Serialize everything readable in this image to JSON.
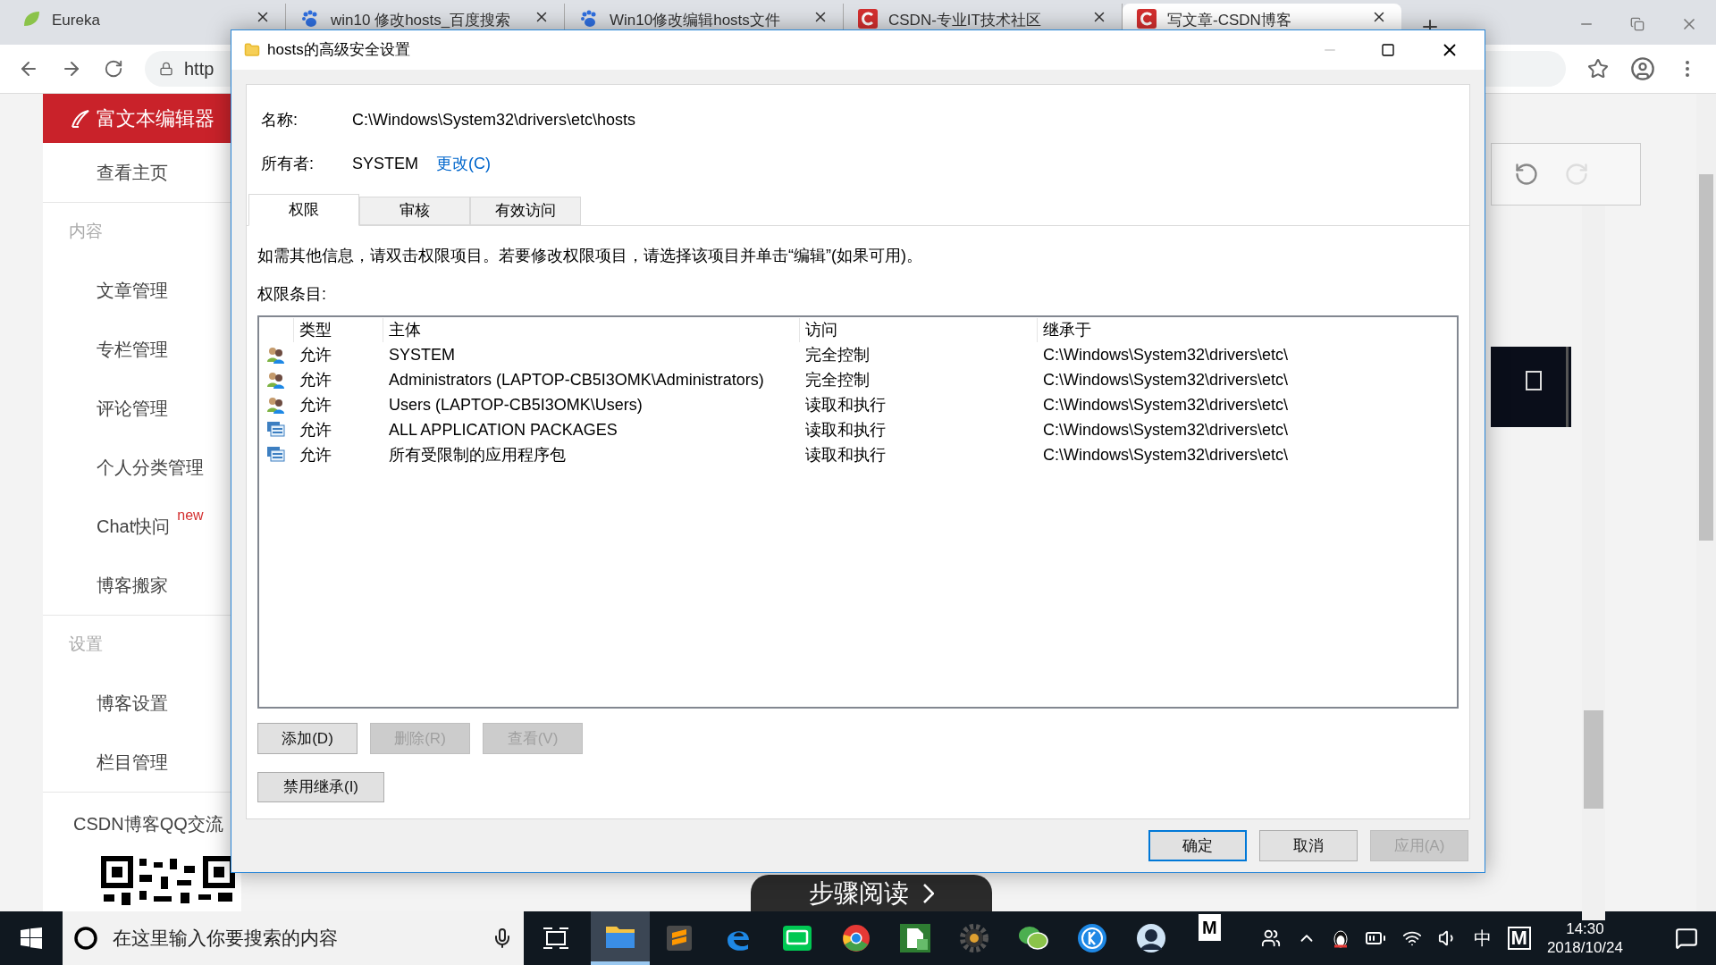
{
  "browser": {
    "tabs": [
      {
        "title": "Eureka",
        "kind": "leaf",
        "selected": false
      },
      {
        "title": "win10 修改hosts_百度搜索",
        "kind": "paw",
        "selected": false
      },
      {
        "title": "Win10修改编辑hosts文件",
        "kind": "paw",
        "selected": false
      },
      {
        "title": "CSDN-专业IT技术社区",
        "kind": "csdn",
        "selected": false
      },
      {
        "title": "写文章-CSDN博客",
        "kind": "csdn",
        "selected": true
      }
    ],
    "address": "http"
  },
  "sidebar": {
    "header": "富文本编辑器",
    "items": [
      {
        "kind": "link",
        "label": "查看主页"
      },
      {
        "kind": "heading",
        "label": "内容"
      },
      {
        "kind": "link",
        "label": "文章管理"
      },
      {
        "kind": "link",
        "label": "专栏管理"
      },
      {
        "kind": "link",
        "label": "评论管理"
      },
      {
        "kind": "link",
        "label": "个人分类管理"
      },
      {
        "kind": "link",
        "label": "Chat快问",
        "badge": "new"
      },
      {
        "kind": "link",
        "label": "博客搬家"
      },
      {
        "kind": "heading",
        "label": "设置"
      },
      {
        "kind": "link",
        "label": "博客设置"
      },
      {
        "kind": "link",
        "label": "栏目管理"
      }
    ],
    "qq_group": "CSDN博客QQ交流"
  },
  "step_reading": "步骤阅读",
  "dialog": {
    "title": "hosts的高级安全设置",
    "name_label": "名称:",
    "name_value": "C:\\Windows\\System32\\drivers\\etc\\hosts",
    "owner_label": "所有者:",
    "owner_value": "SYSTEM",
    "change_link": "更改(C)",
    "tabs": [
      {
        "label": "权限",
        "selected": true
      },
      {
        "label": "审核",
        "selected": false
      },
      {
        "label": "有效访问",
        "selected": false
      }
    ],
    "description": "如需其他信息，请双击权限项目。若要修改权限项目，请选择该项目并单击“编辑”(如果可用)。",
    "entries_label": "权限条目:",
    "columns": [
      "类型",
      "主体",
      "访问",
      "继承于"
    ],
    "rows": [
      {
        "kind": "group",
        "type": "允许",
        "principal": "SYSTEM",
        "access": "完全控制",
        "inherited_from": "C:\\Windows\\System32\\drivers\\etc\\"
      },
      {
        "kind": "group",
        "type": "允许",
        "principal": "Administrators (LAPTOP-CB5I3OMK\\Administrators)",
        "access": "完全控制",
        "inherited_from": "C:\\Windows\\System32\\drivers\\etc\\"
      },
      {
        "kind": "group",
        "type": "允许",
        "principal": "Users (LAPTOP-CB5I3OMK\\Users)",
        "access": "读取和执行",
        "inherited_from": "C:\\Windows\\System32\\drivers\\etc\\"
      },
      {
        "kind": "package",
        "type": "允许",
        "principal": "ALL APPLICATION PACKAGES",
        "access": "读取和执行",
        "inherited_from": "C:\\Windows\\System32\\drivers\\etc\\"
      },
      {
        "kind": "package",
        "type": "允许",
        "principal": "所有受限制的应用程序包",
        "access": "读取和执行",
        "inherited_from": "C:\\Windows\\System32\\drivers\\etc\\"
      }
    ],
    "entry_buttons": [
      {
        "label": "添加(D)",
        "disabled": false
      },
      {
        "label": "删除(R)",
        "disabled": true
      },
      {
        "label": "查看(V)",
        "disabled": true
      }
    ],
    "inheritance_button": "禁用继承(I)",
    "footer_buttons": [
      {
        "label": "确定",
        "disabled": false,
        "default": true
      },
      {
        "label": "取消",
        "disabled": false,
        "default": false
      },
      {
        "label": "应用(A)",
        "disabled": true,
        "default": false
      }
    ]
  },
  "taskbar": {
    "search_placeholder": "在这里输入你要搜索的内容",
    "apps": [
      {
        "kind": "folder",
        "focused": true
      },
      {
        "kind": "editor",
        "focused": false
      },
      {
        "kind": "edge",
        "focused": false
      },
      {
        "kind": "tv",
        "focused": false
      },
      {
        "kind": "chrome",
        "focused": false
      },
      {
        "kind": "document",
        "focused": false
      },
      {
        "kind": "gear",
        "focused": false
      },
      {
        "kind": "chat",
        "focused": false
      },
      {
        "kind": "bluecircle",
        "focused": false
      },
      {
        "kind": "avatar",
        "focused": false
      }
    ],
    "pinned_letter": "M",
    "ime": "中",
    "ime_mode": "M",
    "time": "14:30",
    "date": "2018/10/24"
  }
}
